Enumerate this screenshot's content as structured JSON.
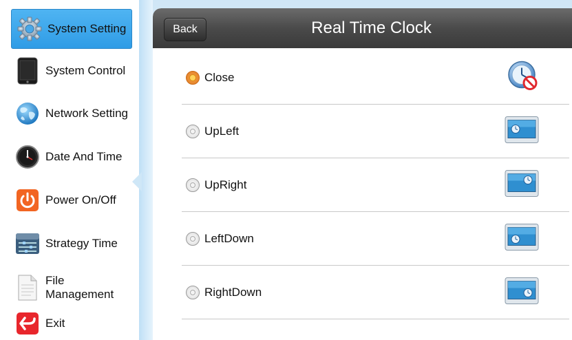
{
  "sidebar": {
    "items": [
      {
        "label": "System Setting",
        "icon": "gear-icon",
        "active": true
      },
      {
        "label": "System Control",
        "icon": "tablet-icon"
      },
      {
        "label": "Network Setting",
        "icon": "globe-icon"
      },
      {
        "label": "Date And Time",
        "icon": "clock-icon"
      },
      {
        "label": "Power On/Off",
        "icon": "power-icon"
      },
      {
        "label": "Strategy Time",
        "icon": "sliders-icon"
      },
      {
        "label_line1": "File",
        "label_line2": "Management",
        "icon": "document-icon"
      },
      {
        "label": "Exit",
        "icon": "exit-icon"
      }
    ]
  },
  "header": {
    "back_label": "Back",
    "title": "Real Time Clock"
  },
  "options": [
    {
      "label": "Close",
      "selected": true,
      "icon": "clock-disabled-icon"
    },
    {
      "label": "UpLeft",
      "selected": false,
      "icon": "screen-clock-icon"
    },
    {
      "label": "UpRight",
      "selected": false,
      "icon": "screen-clock-icon"
    },
    {
      "label": "LeftDown",
      "selected": false,
      "icon": "screen-clock-icon"
    },
    {
      "label": "RightDown",
      "selected": false,
      "icon": "screen-clock-icon"
    }
  ],
  "colors": {
    "active_nav": "#3aa6ec",
    "header": "#4a4a4a",
    "radio_selected": "#e07a20"
  }
}
